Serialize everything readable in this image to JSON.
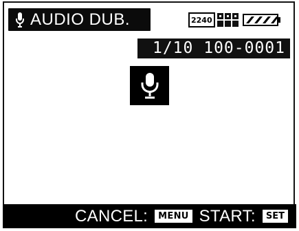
{
  "screen": {
    "title": "AUDIO DUB.",
    "counter": "1/10 100-0001",
    "resolution_badge": "2240",
    "bottom_bar": {
      "cancel_label": "CANCEL:",
      "menu_label": "MENU",
      "start_label": "START:",
      "set_label": "SET"
    }
  },
  "icons": {
    "title_mic": "microphone-icon",
    "quality": "quality-icon",
    "battery": "battery-icon",
    "center_mic": "microphone-icon"
  }
}
